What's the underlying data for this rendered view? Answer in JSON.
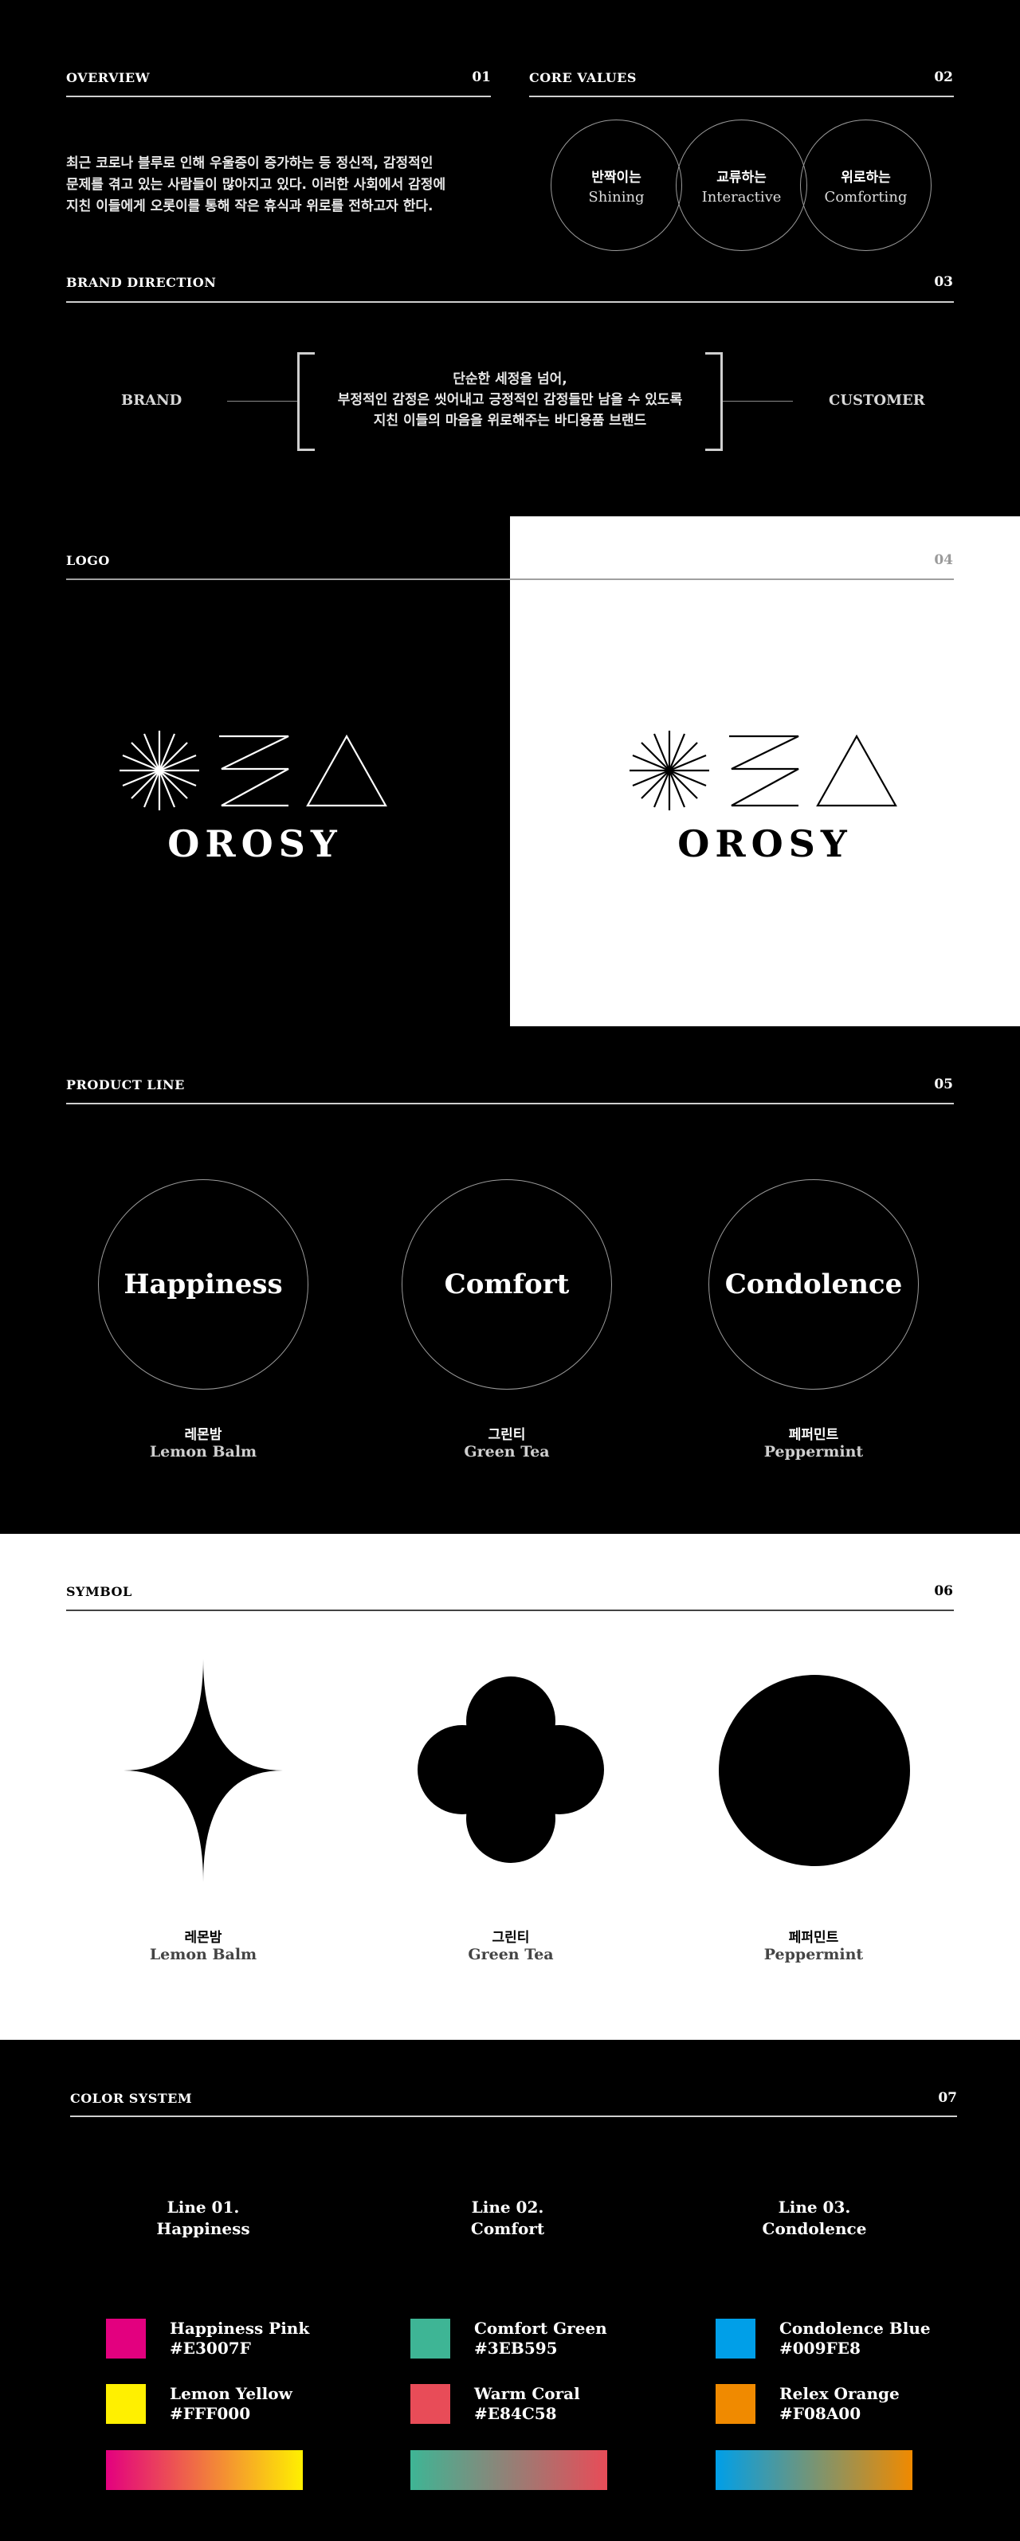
{
  "overview": {
    "label": "OVERVIEW",
    "num": "01",
    "line1": "최근 코로나 블루로 인해 우울증이 증가하는 등 정신적, 감정적인",
    "line2": "문제를 겪고 있는 사람들이 많아지고 있다. 이러한 사회에서 감정에",
    "line3": "지친 이들에게 오롯이를 통해 작은 휴식과 위로를 전하고자 한다."
  },
  "core_values": {
    "label": "CORE VALUES",
    "num": "02",
    "items": [
      {
        "kor": "반짝이는",
        "eng": "Shining"
      },
      {
        "kor": "교류하는",
        "eng": "Interactive"
      },
      {
        "kor": "위로하는",
        "eng": "Comforting"
      }
    ]
  },
  "brand_direction": {
    "label": "BRAND DIRECTION",
    "num": "03",
    "left": "BRAND",
    "right": "CUSTOMER",
    "line1": "단순한 세정을 넘어,",
    "line2": "부정적인 감정은 씻어내고 긍정적인 감정들만 남을 수 있도록",
    "line3": "지친 이들의 마음을 위로해주는 바디용품 브랜드"
  },
  "logo": {
    "label": "LOGO",
    "num": "04",
    "wordmark": "OROSY"
  },
  "product_line": {
    "label": "PRODUCT LINE",
    "num": "05",
    "items": [
      {
        "name": "Happiness",
        "kor": "레몬밤",
        "eng": "Lemon Balm"
      },
      {
        "name": "Comfort",
        "kor": "그린티",
        "eng": "Green Tea"
      },
      {
        "name": "Condolence",
        "kor": "페퍼민트",
        "eng": "Peppermint"
      }
    ]
  },
  "symbol": {
    "label": "SYMBOL",
    "num": "06",
    "items": [
      {
        "icon": "sparkle-icon",
        "kor": "레몬밤",
        "eng": "Lemon Balm"
      },
      {
        "icon": "clover-icon",
        "kor": "그린티",
        "eng": "Green Tea"
      },
      {
        "icon": "circle-icon",
        "kor": "페퍼민트",
        "eng": "Peppermint"
      }
    ]
  },
  "color_system": {
    "label": "COLOR SYSTEM",
    "num": "07",
    "lines": [
      {
        "title1": "Line 01.",
        "title2": "Happiness",
        "c1_name": "Happiness Pink",
        "c1_hex": "#E3007F",
        "c2_name": "Lemon Yellow",
        "c2_hex": "#FFF000"
      },
      {
        "title1": "Line 02.",
        "title2": "Comfort",
        "c1_name": "Comfort Green",
        "c1_hex": "#3EB595",
        "c2_name": "Warm Coral",
        "c2_hex": "#E84C58"
      },
      {
        "title1": "Line 03.",
        "title2": "Condolence",
        "c1_name": "Condolence Blue",
        "c1_hex": "#009FE8",
        "c2_name": "Relex Orange",
        "c2_hex": "#F08A00"
      }
    ]
  }
}
